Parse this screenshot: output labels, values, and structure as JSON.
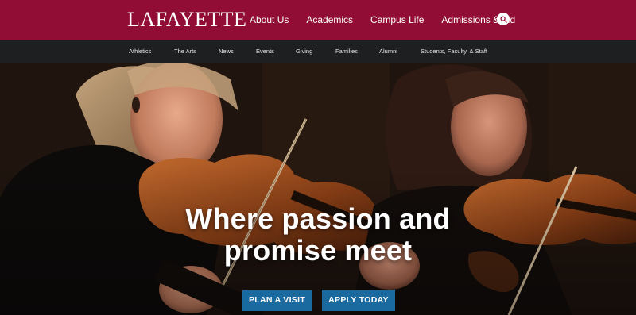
{
  "header": {
    "logo": "LAFAYETTE",
    "main_nav": [
      "About Us",
      "Academics",
      "Campus Life",
      "Admissions & Aid"
    ],
    "search_icon": "search-icon",
    "brand_color": "#910d36"
  },
  "sub_nav": [
    "Athletics",
    "The Arts",
    "News",
    "Events",
    "Giving",
    "Families",
    "Alumni",
    "Students, Faculty, & Staff"
  ],
  "hero": {
    "title_line1": "Where passion and",
    "title_line2": "promise meet",
    "buttons": {
      "plan_visit": "PLAN A VISIT",
      "apply_today": "APPLY TODAY"
    },
    "button_color": "#1a6aa0"
  }
}
